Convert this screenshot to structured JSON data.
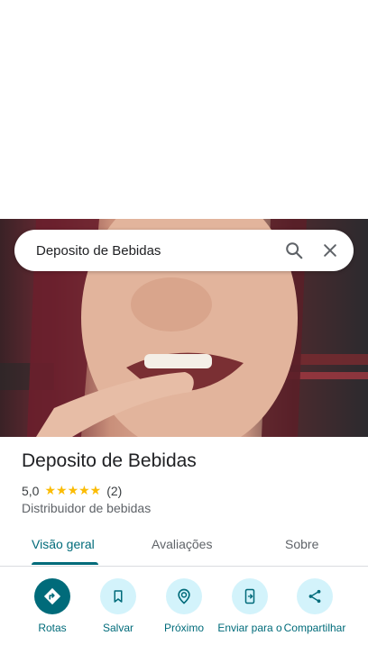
{
  "search": {
    "query": "Deposito de Bebidas"
  },
  "place": {
    "name": "Deposito de Bebidas",
    "rating": "5,0",
    "stars": "★★★★★",
    "review_count": "(2)",
    "category": "Distribuidor de bebidas"
  },
  "tabs": [
    {
      "label": "Visão geral",
      "active": true
    },
    {
      "label": "Avaliações",
      "active": false
    },
    {
      "label": "Sobre",
      "active": false
    }
  ],
  "actions": [
    {
      "label": "Rotas",
      "icon": "directions-icon",
      "primary": true
    },
    {
      "label": "Salvar",
      "icon": "bookmark-icon",
      "primary": false
    },
    {
      "label": "Próximo",
      "icon": "nearby-icon",
      "primary": false
    },
    {
      "label": "Enviar para o",
      "icon": "send-to-phone-icon",
      "primary": false
    },
    {
      "label": "Compartilhar",
      "icon": "share-icon",
      "primary": false
    }
  ],
  "colors": {
    "accent": "#006b7a",
    "accent_light": "#d3f3fb",
    "star": "#fbbc04"
  }
}
